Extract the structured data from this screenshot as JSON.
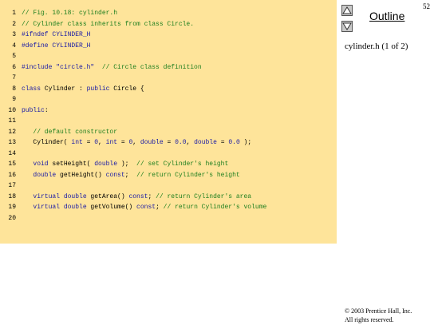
{
  "page_number": "52",
  "sidebar": {
    "outline_label": "Outline",
    "file_label": "cylinder.h (1 of 2)",
    "nav_up_icon": "triangle-up-icon",
    "nav_down_icon": "triangle-down-icon"
  },
  "copyright": {
    "line1": "© 2003 Prentice Hall, Inc.",
    "line2": "All rights reserved."
  },
  "colors": {
    "panel": "#fee49a",
    "comment": "#1f7f1f",
    "keyword": "#1a1aa6"
  },
  "code": [
    {
      "n": "1",
      "segs": [
        {
          "t": "// Fig. 10.18: cylinder.h",
          "c": "c"
        }
      ]
    },
    {
      "n": "2",
      "segs": [
        {
          "t": "// Cylinder class inherits from class Circle.",
          "c": "c"
        }
      ]
    },
    {
      "n": "3",
      "segs": [
        {
          "t": "#ifndef CYLINDER_H",
          "c": "k"
        }
      ]
    },
    {
      "n": "4",
      "segs": [
        {
          "t": "#define CYLINDER_H",
          "c": "k"
        }
      ]
    },
    {
      "n": "5",
      "segs": []
    },
    {
      "n": "6",
      "segs": [
        {
          "t": "#include ",
          "c": "k"
        },
        {
          "t": "\"circle.h\"",
          "c": "s"
        },
        {
          "t": "  // Circle class definition",
          "c": "c"
        }
      ]
    },
    {
      "n": "7",
      "segs": []
    },
    {
      "n": "8",
      "segs": [
        {
          "t": "class ",
          "c": "k"
        },
        {
          "t": "Cylinder : "
        },
        {
          "t": "public ",
          "c": "k"
        },
        {
          "t": "Circle {"
        }
      ]
    },
    {
      "n": "9",
      "segs": []
    },
    {
      "n": "10",
      "segs": [
        {
          "t": "public",
          "c": "k"
        },
        {
          "t": ":"
        }
      ]
    },
    {
      "n": "11",
      "segs": []
    },
    {
      "n": "12",
      "segs": [
        {
          "t": "   // default constructor",
          "c": "c"
        }
      ]
    },
    {
      "n": "13",
      "segs": [
        {
          "t": "   Cylinder( "
        },
        {
          "t": "int",
          "c": "k"
        },
        {
          "t": " = "
        },
        {
          "t": "0",
          "c": "k"
        },
        {
          "t": ", "
        },
        {
          "t": "int",
          "c": "k"
        },
        {
          "t": " = "
        },
        {
          "t": "0",
          "c": "k"
        },
        {
          "t": ", "
        },
        {
          "t": "double",
          "c": "k"
        },
        {
          "t": " = "
        },
        {
          "t": "0.0",
          "c": "k"
        },
        {
          "t": ", "
        },
        {
          "t": "double",
          "c": "k"
        },
        {
          "t": " = "
        },
        {
          "t": "0.0",
          "c": "k"
        },
        {
          "t": " );"
        }
      ]
    },
    {
      "n": "14",
      "segs": []
    },
    {
      "n": "15",
      "segs": [
        {
          "t": "   "
        },
        {
          "t": "void",
          "c": "k"
        },
        {
          "t": " setHeight( "
        },
        {
          "t": "double",
          "c": "k"
        },
        {
          "t": " );  "
        },
        {
          "t": "// set Cylinder's height",
          "c": "c"
        }
      ]
    },
    {
      "n": "16",
      "segs": [
        {
          "t": "   "
        },
        {
          "t": "double",
          "c": "k"
        },
        {
          "t": " getHeight() "
        },
        {
          "t": "const",
          "c": "k"
        },
        {
          "t": ";  "
        },
        {
          "t": "// return Cylinder's height",
          "c": "c"
        }
      ]
    },
    {
      "n": "17",
      "segs": []
    },
    {
      "n": "18",
      "segs": [
        {
          "t": "   "
        },
        {
          "t": "virtual double",
          "c": "k"
        },
        {
          "t": " getArea() "
        },
        {
          "t": "const",
          "c": "k"
        },
        {
          "t": "; "
        },
        {
          "t": "// return Cylinder's area",
          "c": "c"
        }
      ]
    },
    {
      "n": "19",
      "segs": [
        {
          "t": "   "
        },
        {
          "t": "virtual double",
          "c": "k"
        },
        {
          "t": " getVolume() "
        },
        {
          "t": "const",
          "c": "k"
        },
        {
          "t": "; "
        },
        {
          "t": "// return Cylinder's volume",
          "c": "c"
        }
      ]
    },
    {
      "n": "20",
      "segs": []
    }
  ]
}
